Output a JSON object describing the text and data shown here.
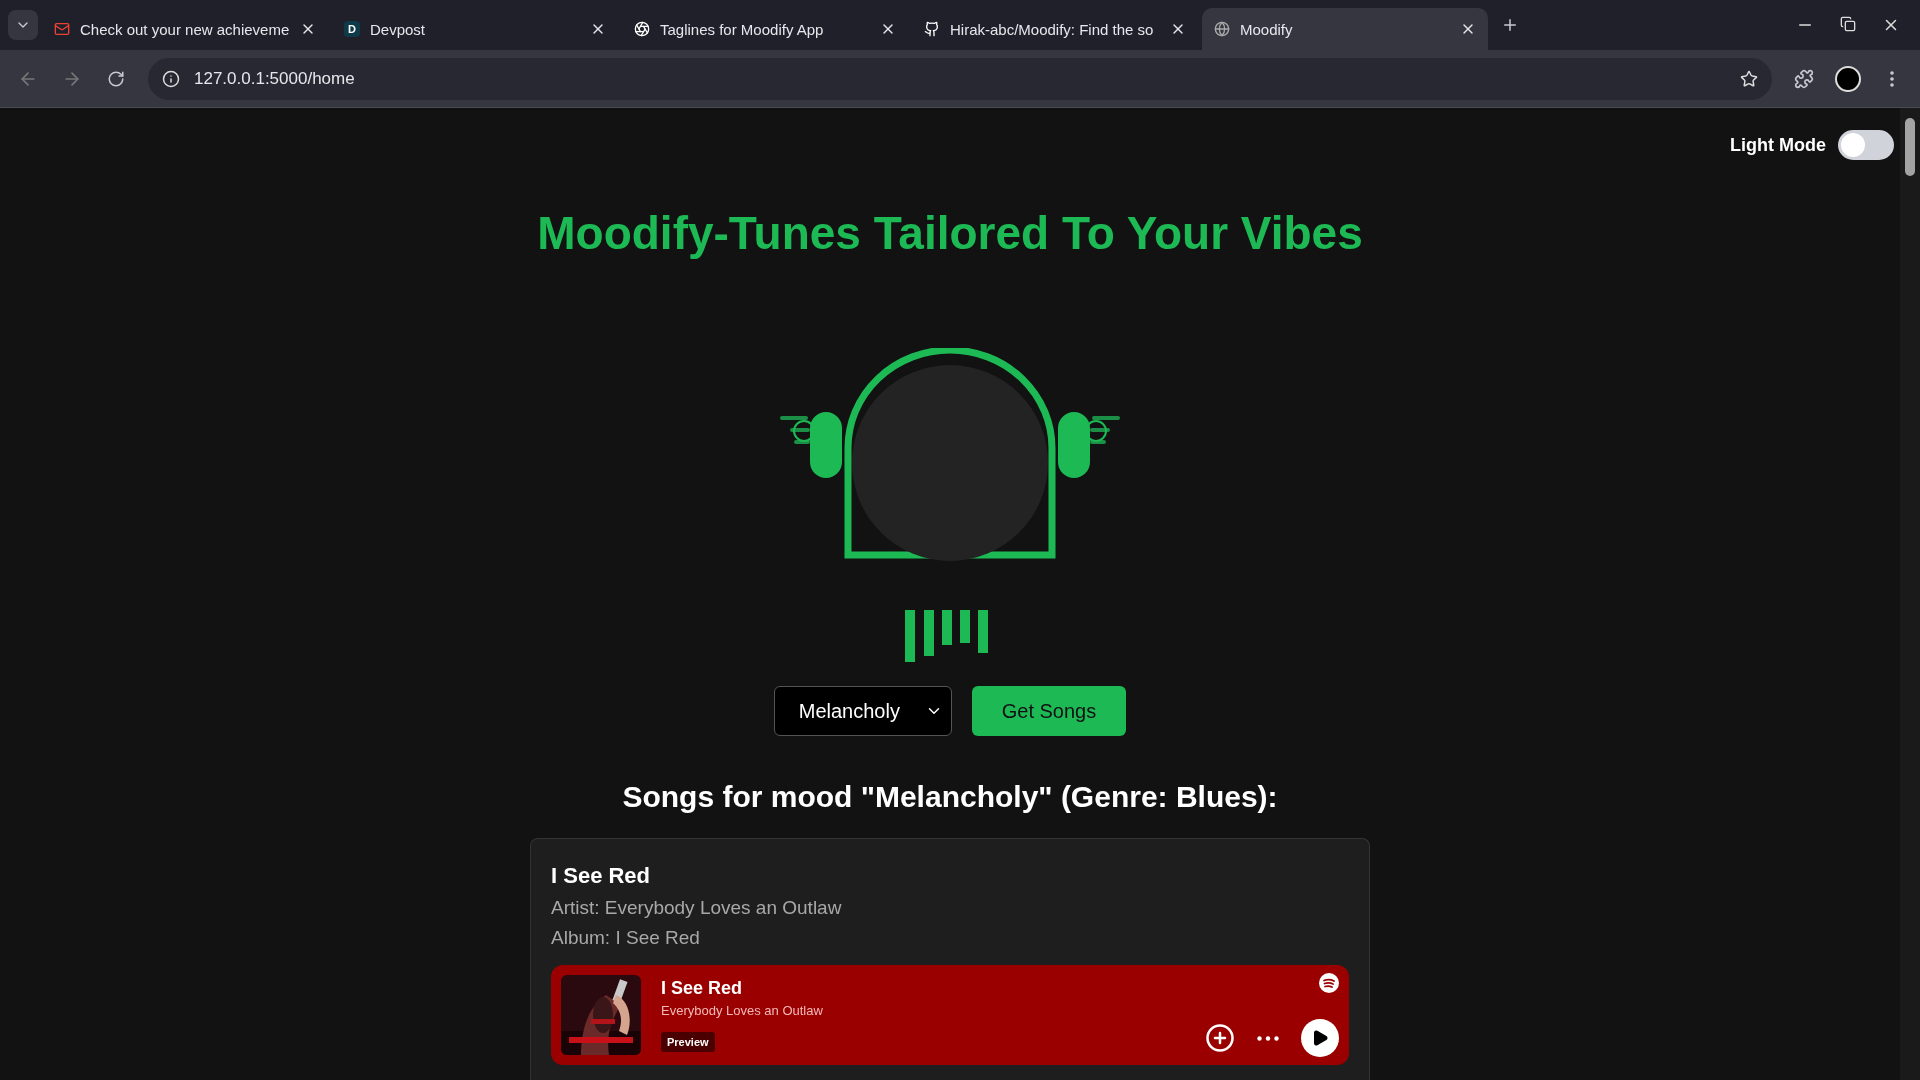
{
  "browser": {
    "tabs": [
      {
        "title": "Check out your new achieveme",
        "selected": false
      },
      {
        "title": "Devpost",
        "letter": "D",
        "selected": false
      },
      {
        "title": "Taglines for Moodify App",
        "selected": false
      },
      {
        "title": "Hirak-abc/Moodify: Find the so",
        "selected": false
      },
      {
        "title": "Moodify",
        "selected": true
      }
    ],
    "url": "127.0.0.1:5000/home"
  },
  "theme_toggle": {
    "label": "Light Mode",
    "on": false
  },
  "title": "Moodify-Tunes Tailored To Your Vibes",
  "mood_select": {
    "value": "Melancholy"
  },
  "get_songs_button": "Get Songs",
  "results_heading": "Songs for mood \"Melancholy\" (Genre: Blues):",
  "songs": [
    {
      "title": "I See Red",
      "artist": "Artist: Everybody Loves an Outlaw",
      "album": "Album: I See Red",
      "player": {
        "title": "I See Red",
        "artist": "Everybody Loves an Outlaw",
        "badge": "Preview",
        "color": "#9b0000"
      }
    }
  ]
}
